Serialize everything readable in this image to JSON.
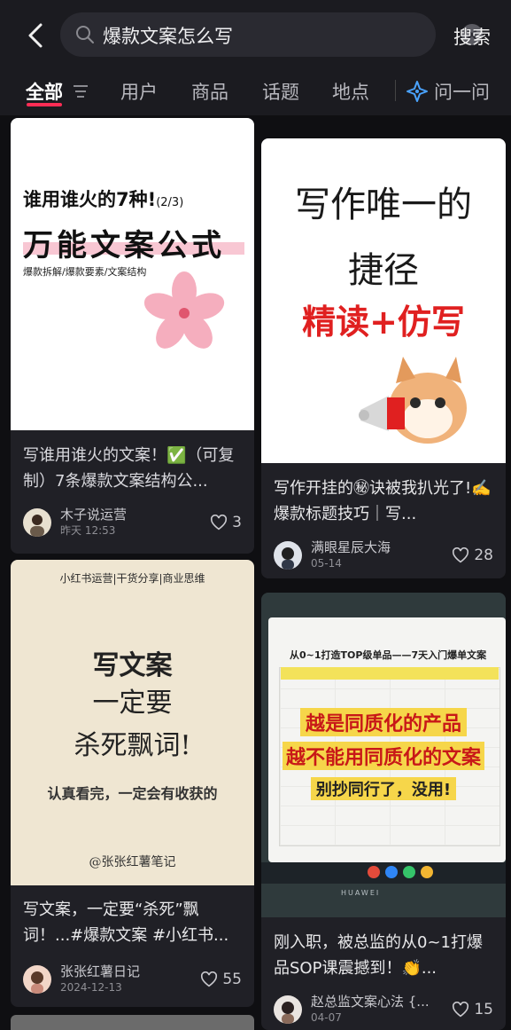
{
  "search": {
    "query": "爆款文案怎么写",
    "button_label": "搜索"
  },
  "tabs": [
    {
      "label": "全部"
    },
    {
      "label": "用户"
    },
    {
      "label": "商品"
    },
    {
      "label": "话题"
    },
    {
      "label": "地点"
    },
    {
      "label": "问一问"
    }
  ],
  "cards": [
    {
      "cover": {
        "line1": "谁用谁火的7种!",
        "line1_small": "(2/3)",
        "line2": "万能文案公式",
        "line3": "爆款拆解/爆款要素/文案结构"
      },
      "title": "写谁用谁火的文案！✅（可复制）7条爆款文案结构公...",
      "author": "木子说运营",
      "date": "昨天 12:53",
      "likes": "3"
    },
    {
      "cover": {
        "line1": "写作唯一的",
        "line2": "捷径",
        "line3": "精读+仿写"
      },
      "title": "写作开挂的㊙诀被我扒光了!✍️爆款标题技巧｜写...",
      "author": "满眼星辰大海",
      "date": "05-14",
      "likes": "28"
    },
    {
      "cover": {
        "top": "小红书运营|干货分享|商业思维",
        "line1": "写文案",
        "line2": "一定要",
        "line3": "杀死飘词!",
        "line4": "认真看完，一定会有收获的",
        "sign": "@张张红薯笔记"
      },
      "title": "写文案，一定要“杀死”飘词！...#爆款文案 #小红书...",
      "author": "张张红薯日记",
      "date": "2024-12-13",
      "likes": "55"
    },
    {
      "cover": {
        "doc_title": "从0~1打造TOP级单品——7天入门爆单文案",
        "overlay1": "越是同质化的产品",
        "overlay2": "越不能用同质化的文案",
        "overlay3": "别抄同行了，没用!",
        "brand": "HUAWEI"
      },
      "title": "刚入职，被总监的从0~1打爆品SOP课震撼到！👏...",
      "author": "赵总监文案心法 {...",
      "date": "04-07",
      "likes": "15"
    }
  ]
}
